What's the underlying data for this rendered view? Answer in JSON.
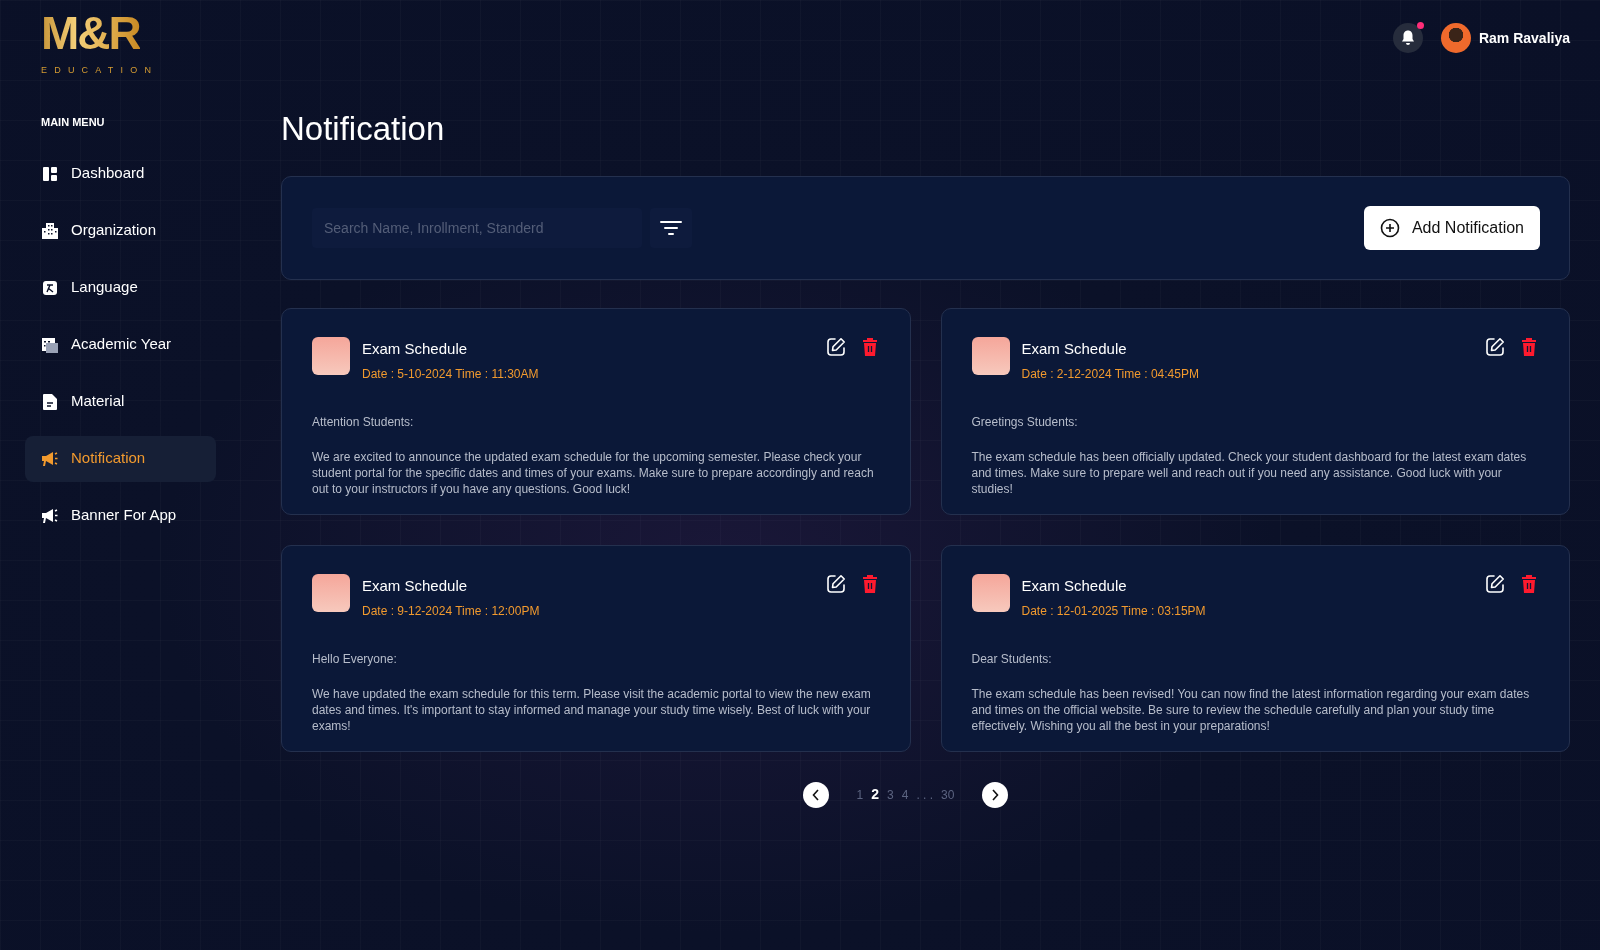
{
  "logo": {
    "title": "M&R",
    "subtitle": "EDUCATION"
  },
  "user": {
    "name": "Ram Ravaliya",
    "has_unread": true
  },
  "sidebar": {
    "heading": "MAIN MENU",
    "items": [
      {
        "label": "Dashboard",
        "kind": "dashboard",
        "selected": false
      },
      {
        "label": "Organization",
        "kind": "building",
        "selected": false
      },
      {
        "label": "Language",
        "kind": "language",
        "selected": false
      },
      {
        "label": "Academic Year",
        "kind": "calendar",
        "selected": false
      },
      {
        "label": "Material",
        "kind": "document",
        "selected": false
      },
      {
        "label": "Notification",
        "kind": "megaphone",
        "selected": true
      },
      {
        "label": "Banner For App",
        "kind": "megaphone",
        "selected": false
      }
    ]
  },
  "page_title": "Notification",
  "search": {
    "placeholder": "Search Name, Inrollment, Standerd"
  },
  "add_button": "Add Notification",
  "notifications": [
    {
      "title": "Exam Schedule",
      "meta": "Date : 5-10-2024 Time : 11:30AM",
      "greeting": "Attention Students:",
      "body": "We are excited to announce the updated exam schedule for the upcoming semester. Please check your student portal for the specific dates and times of your exams. Make sure to prepare accordingly and reach out to your instructors if you have any questions. Good luck!"
    },
    {
      "title": "Exam Schedule",
      "meta": "Date : 2-12-2024 Time : 04:45PM",
      "greeting": "Greetings Students:",
      "body": "The exam schedule has been officially updated. Check your student dashboard for the latest exam dates and times. Make sure to prepare well and reach out if you need any assistance. Good luck with your studies!"
    },
    {
      "title": "Exam Schedule",
      "meta": "Date : 9-12-2024 Time : 12:00PM",
      "greeting": "Hello Everyone:",
      "body": "We have updated the exam schedule for this term. Please visit the academic portal to view the new exam dates and times. It's important to stay informed and manage your study time wisely. Best of luck with your exams!"
    },
    {
      "title": "Exam Schedule",
      "meta": "Date : 12-01-2025 Time : 03:15PM",
      "greeting": "Dear Students:",
      "body": "The exam schedule has been revised! You can now find the latest information regarding your exam dates and times on the official website. Be sure to review the schedule carefully and plan your study time effectively. Wishing you all the best in your preparations!"
    }
  ],
  "pagination": {
    "pages": [
      {
        "label": "1",
        "kind": "page",
        "selected": false
      },
      {
        "label": "2",
        "kind": "page",
        "selected": true
      },
      {
        "label": "3",
        "kind": "page",
        "selected": false
      },
      {
        "label": "4",
        "kind": "page",
        "selected": false
      },
      {
        "label": ". . .",
        "kind": "ellipsis"
      },
      {
        "label": "30",
        "kind": "page",
        "selected": false
      }
    ]
  }
}
